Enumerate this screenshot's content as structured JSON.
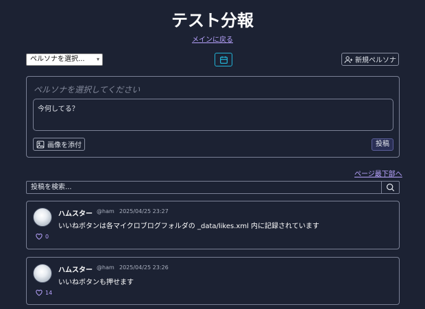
{
  "header": {
    "title": "テスト分報",
    "back_link": "メインに戻る"
  },
  "toolbar": {
    "persona_select_value": "ペルソナを選択...",
    "new_persona_label": "新規ペルソナ"
  },
  "compose": {
    "persona_placeholder": "ペルソナを選択してください",
    "textarea_placeholder": "今何してる？",
    "attach_label": "画像を添付",
    "submit_label": "投稿"
  },
  "jump_link": "ページ最下部へ",
  "search": {
    "placeholder": "投稿を検索..."
  },
  "posts": [
    {
      "name": "ハムスター",
      "handle": "@ham",
      "time": "2025/04/25 23:27",
      "body": "いいねボタンは各マイクロブログフォルダの _data/likes.xml 内に記録されています",
      "likes": "0"
    },
    {
      "name": "ハムスター",
      "handle": "@ham",
      "time": "2025/04/25 23:26",
      "body": "いいねボタンも押せます",
      "likes": "14"
    }
  ],
  "colors": {
    "background": "#1c2233",
    "accent_link": "#b9a4ff",
    "calendar_accent": "#22b3d6"
  },
  "icons": [
    "calendar-icon",
    "user-plus-icon",
    "image-icon",
    "search-icon",
    "heart-icon"
  ]
}
